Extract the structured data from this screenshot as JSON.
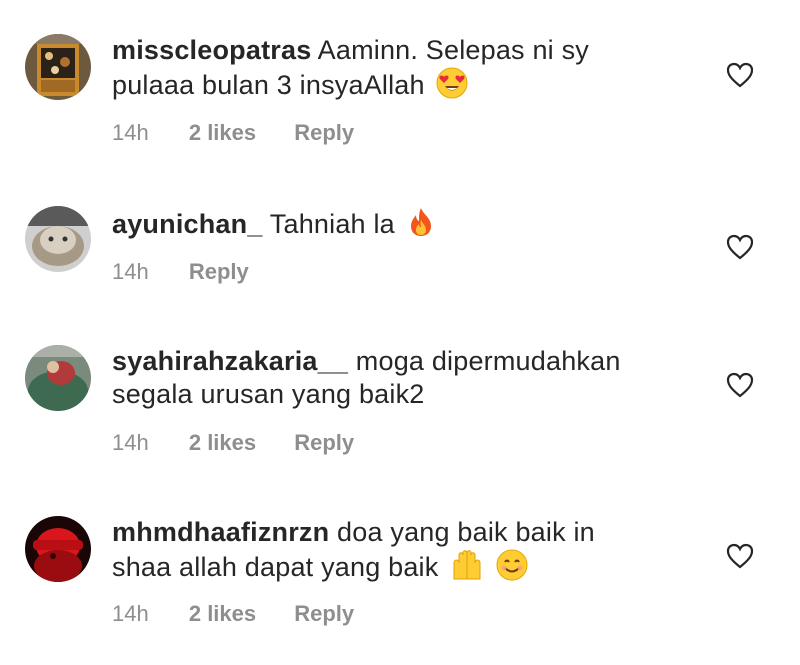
{
  "comments": [
    {
      "username": "misscleopatras",
      "text_line1": "Aaminn. Selepas ni sy",
      "text_line2": "pulaaa bulan 3 insyaAllah",
      "emoji": "heart-eyes",
      "time": "14h",
      "likes": "2 likes",
      "reply": "Reply"
    },
    {
      "username": "ayunichan_",
      "text_line1": "Tahniah la",
      "emoji": "fire",
      "time": "14h",
      "reply": "Reply"
    },
    {
      "username": "syahirahzakaria__",
      "text_line1": "moga dipermudahkan",
      "text_line2": "segala urusan yang baik2",
      "time": "14h",
      "likes": "2 likes",
      "reply": "Reply"
    },
    {
      "username": "mhmdhaafiznrzn",
      "text_line1": "doa yang baik baik in",
      "text_line2": "shaa allah dapat yang baik",
      "emoji": "raised-hands, smiling-face",
      "time": "14h",
      "likes": "2 likes",
      "reply": "Reply"
    }
  ],
  "colors": {
    "text": "#262626",
    "muted": "#8e8e8e",
    "heart_stroke": "#262626"
  }
}
